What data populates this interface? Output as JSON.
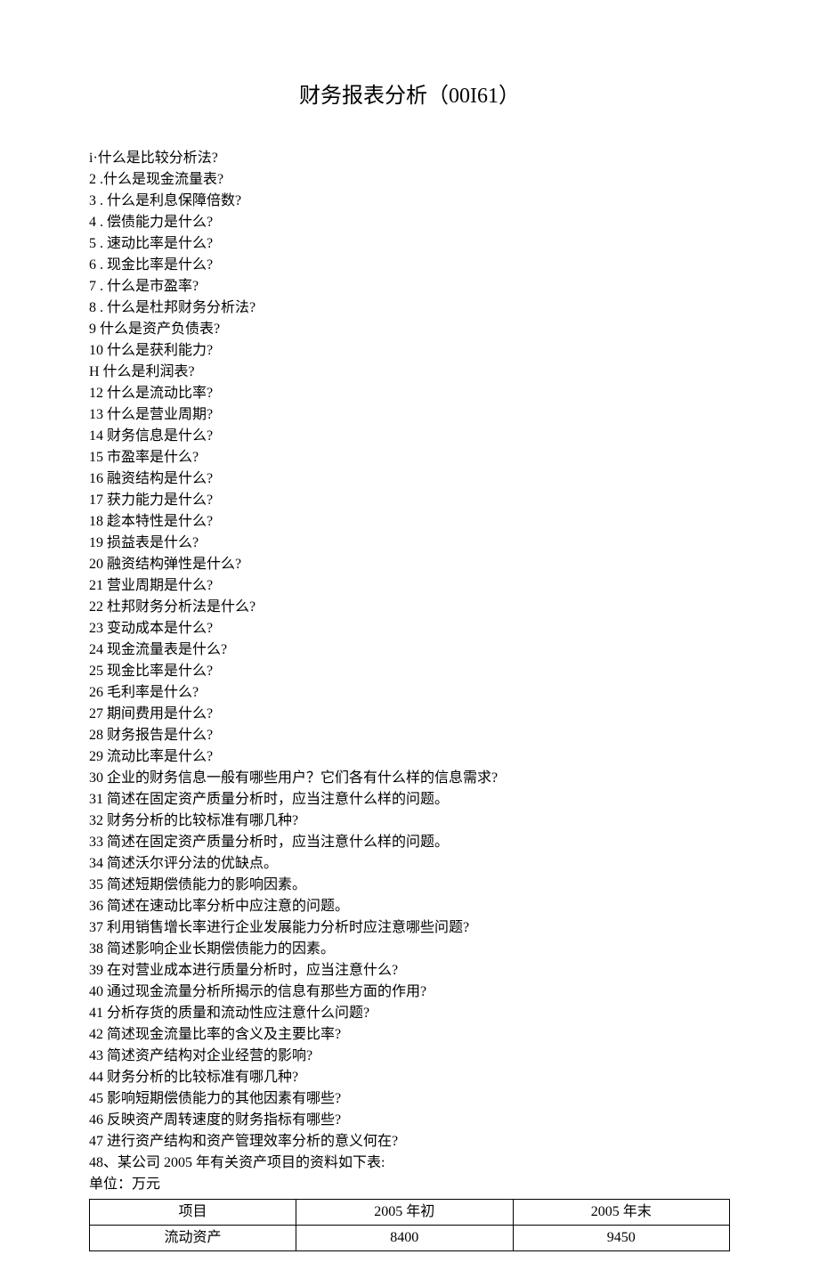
{
  "title": "财务报表分析（00I61）",
  "questions": [
    "i·什么是比较分析法?",
    "2 .什么是现金流量表?",
    "3 . 什么是利息保障倍数?",
    "4 . 偿债能力是什么?",
    "5 . 速动比率是什么?",
    "6 . 现金比率是什么?",
    "7 . 什么是市盈率?",
    "8 . 什么是杜邦财务分析法?",
    "9 什么是资产负债表?",
    "10 什么是获利能力?",
    "H 什么是利润表?",
    "12 什么是流动比率?",
    "13 什么是营业周期?",
    "14 财务信息是什么?",
    "15 市盈率是什么?",
    "16 融资结构是什么?",
    "17 获力能力是什么?",
    "18 趁本特性是什么?",
    "19 损益表是什么?",
    "20 融资结构弹性是什么?",
    "21 营业周期是什么?",
    "22 杜邦财务分析法是什么?",
    "23 变动成本是什么?",
    "24 现金流量表是什么?",
    "25 现金比率是什么?",
    "26 毛利率是什么?",
    "27 期间费用是什么?",
    "28 财务报告是什么?",
    "29 流动比率是什么?",
    "30 企业的财务信息一般有哪些用户？它们各有什么样的信息需求?",
    "31 简述在固定资产质量分析时，应当注意什么样的问题。",
    "32 财务分析的比较标准有哪几种?",
    "33 简述在固定资产质量分析时，应当注意什么样的问题。",
    "34 简述沃尔评分法的优缺点。",
    "35 简述短期偿债能力的影响因素。",
    "36 简述在速动比率分析中应注意的问题。",
    "37 利用销售增长率进行企业发展能力分析时应注意哪些问题?",
    "38 简述影响企业长期偿债能力的因素。",
    "39 在对营业成本进行质量分析时，应当注意什么?",
    "40 通过现金流量分析所揭示的信息有那些方面的作用?",
    "41 分析存货的质量和流动性应注意什么问题?",
    "42 简述现金流量比率的含义及主要比率?",
    "43 简述资产结构对企业经营的影响?",
    "44 财务分析的比较标准有哪几种?",
    "45 影响短期偿债能力的其他因素有哪些?",
    "46 反映资产周转速度的财务指标有哪些?",
    "47 进行资产结构和资产管理效率分析的意义何在?",
    "48、某公司 2005 年有关资产项目的资料如下表:",
    "单位：万元"
  ],
  "table": {
    "headers": [
      "项目",
      "2005 年初",
      "2005 年末"
    ],
    "rows": [
      [
        "流动资产",
        "8400",
        "9450"
      ]
    ]
  }
}
